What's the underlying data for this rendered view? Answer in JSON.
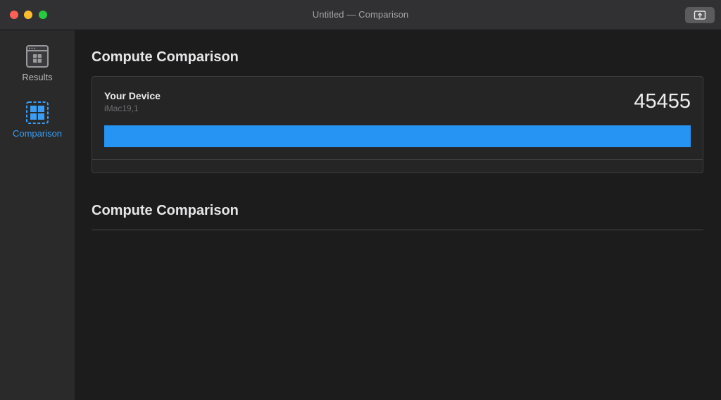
{
  "window": {
    "title": "Untitled — Comparison"
  },
  "titlebar": {
    "share_icon": "share-icon"
  },
  "sidebar": {
    "items": [
      {
        "label": "Results",
        "icon": "results-icon",
        "selected": false
      },
      {
        "label": "Comparison",
        "icon": "comparison-icon",
        "selected": true
      }
    ]
  },
  "main": {
    "sections": [
      {
        "title": "Compute Comparison",
        "devices": [
          {
            "name": "Your Device",
            "model": "iMac19,1",
            "score": "45455",
            "bar_fraction": 1.0,
            "bar_color": "#2594f2"
          }
        ]
      },
      {
        "title": "Compute Comparison"
      }
    ]
  },
  "colors": {
    "accent": "#3a9ef5",
    "bar": "#2594f2",
    "close": "#fe5f57",
    "minimize": "#febc2e",
    "zoom": "#28c840"
  }
}
